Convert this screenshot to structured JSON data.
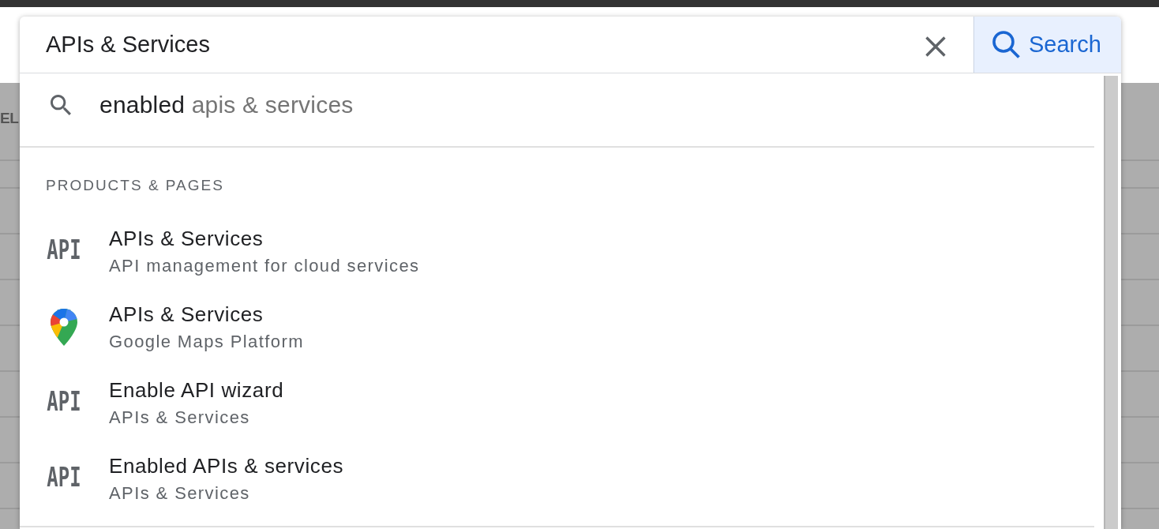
{
  "background_page": {
    "column_label": "EL"
  },
  "search_bar": {
    "value": "APIs & Services",
    "button_label": "Search"
  },
  "suggestions": [
    {
      "typed": "enabled",
      "completion": "apis & services"
    }
  ],
  "results": {
    "heading": "PRODUCTS & PAGES",
    "items": [
      {
        "icon": {
          "kind": "text-logo",
          "text": "API"
        },
        "title": "APIs & Services",
        "subtitle": "API management for cloud services"
      },
      {
        "icon": {
          "kind": "map-pin"
        },
        "title": "APIs & Services",
        "subtitle": "Google Maps Platform"
      },
      {
        "icon": {
          "kind": "text-logo",
          "text": "API"
        },
        "title": "Enable API wizard",
        "subtitle": "APIs & Services"
      },
      {
        "icon": {
          "kind": "text-logo",
          "text": "API"
        },
        "title": "Enabled APIs & services",
        "subtitle": "APIs & Services"
      }
    ]
  }
}
